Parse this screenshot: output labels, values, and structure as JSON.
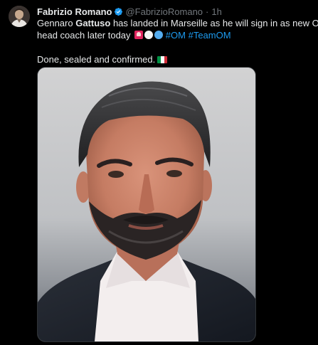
{
  "author": {
    "display_name": "Fabrizio Romano",
    "handle": "@FabrizioRomano",
    "separator": "·",
    "time": "1h",
    "verified_color": "#1d9bf0"
  },
  "tweet": {
    "line1": {
      "pre": "Gennaro ",
      "bold": "Gattuso",
      "post": " has landed in Marseille as he will sign in as new OM"
    },
    "line2": {
      "text": "head coach later today",
      "emojis": [
        "police-light-emoji",
        "white-circle-emoji",
        "blue-circle-emoji"
      ],
      "hashtags": [
        "#OM",
        "#TeamOM"
      ]
    },
    "line3": {
      "text": "Done, sealed and confirmed.",
      "emoji": "italy-flag-emoji"
    }
  },
  "media": {
    "type": "photo",
    "subject": "portrait-photo"
  },
  "colors": {
    "background": "#000000",
    "text": "#e7e9ea",
    "muted": "#71767b",
    "link": "#1d9bf0",
    "border": "#2f3336"
  }
}
